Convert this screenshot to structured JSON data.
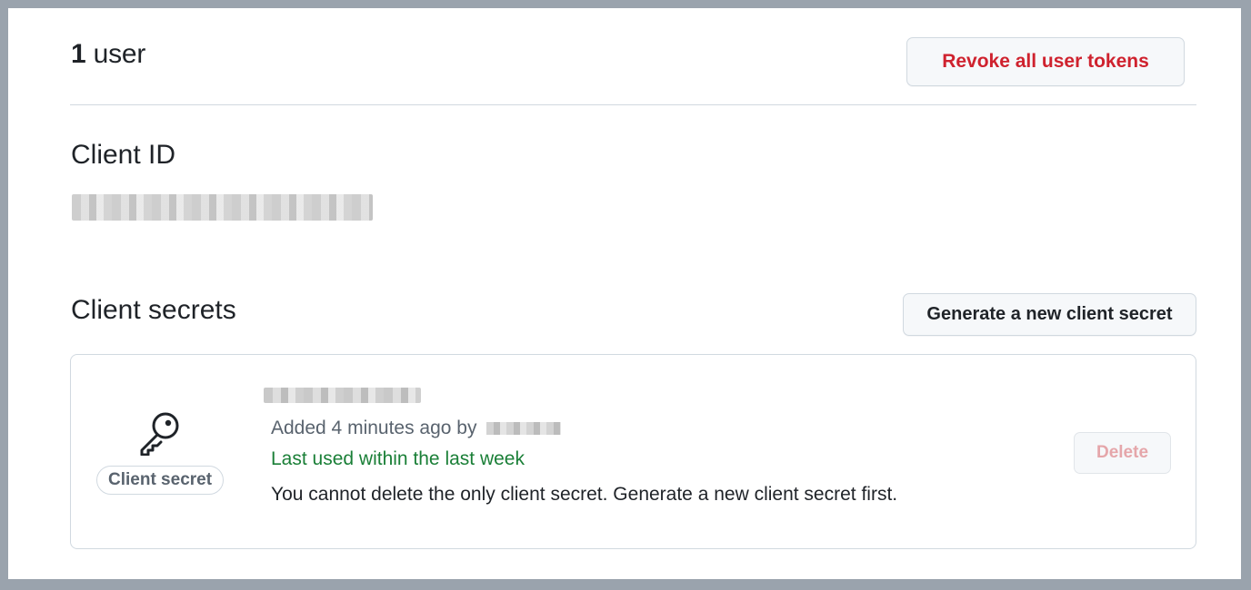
{
  "users": {
    "count": "1",
    "label": "user"
  },
  "actions": {
    "revoke_label": "Revoke all user tokens",
    "generate_label": "Generate a new client secret"
  },
  "client_id": {
    "heading": "Client ID"
  },
  "client_secrets": {
    "heading": "Client secrets",
    "items": [
      {
        "badge": "Client secret",
        "icon": "key-icon",
        "added_prefix": "Added 4 minutes ago by",
        "last_used": "Last used within the last week",
        "note": "You cannot delete the only client secret. Generate a new client secret first.",
        "delete_label": "Delete"
      }
    ]
  },
  "colors": {
    "danger": "#cf222e",
    "success": "#1a7f37",
    "muted": "#59636e",
    "border": "#d1d9e0",
    "button_bg": "#f6f8fa"
  }
}
